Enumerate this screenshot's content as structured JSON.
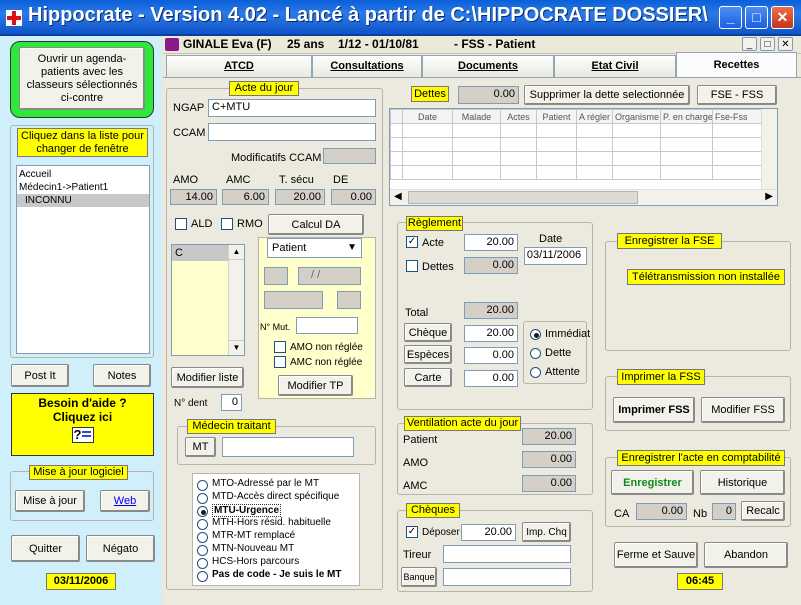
{
  "window": {
    "title": "Hippocrate - Version 4.02 - Lancé à partir de C:\\HIPPOCRATE DOSSIER\\",
    "min": "_",
    "max": "□",
    "close": "✕"
  },
  "sidebar": {
    "open_agenda": "Ouvrir un agenda-patients avec les classeurs sélectionnés ci-contre",
    "window_list_label": "Cliquez dans la liste pour changer de fenêtre",
    "window_list": [
      "Accueil",
      "Médecin1->Patient1",
      "INCONNU"
    ],
    "post_it": "Post It",
    "notes": "Notes",
    "help_line1": "Besoin d'aide ?",
    "help_line2": "Cliquez ici",
    "update_label": "Mise à jour logiciel",
    "update_button": "Mise à jour",
    "web_button": "Web",
    "quit": "Quitter",
    "negato": "Négato",
    "date": "03/11/2006"
  },
  "patient_bar": {
    "name": "GINALE Eva (F)",
    "age": "25 ans",
    "age_detail": "1/12 - 01/10/81",
    "status": "- FSS - Patient",
    "min": "_",
    "max": "□",
    "close": "✕"
  },
  "tabs": [
    "ATCD",
    "Consultations",
    "Documents",
    "Etat Civil",
    "Recettes"
  ],
  "acte": {
    "title": "Acte du jour",
    "ngap_label": "NGAP",
    "ngap_value": "C+MTU",
    "ccam_label": "CCAM",
    "ccam_value": "",
    "modifs_label": "Modificatifs CCAM",
    "amo_label": "AMO",
    "amc_label": "AMC",
    "tsecu_label": "T. sécu",
    "de_label": "DE",
    "amo": "14.00",
    "amc": "6.00",
    "tsecu": "20.00",
    "de": "0.00",
    "ald": "ALD",
    "rmo": "RMO",
    "calcul_da": "Calcul DA",
    "list_item": "C",
    "payer": "Patient",
    "date_placeholder": "/ /",
    "num_mut": "N° Mut.",
    "amo_non_reglee": "AMO non réglée",
    "amc_non_reglee": "AMC non réglée",
    "modifier_tp": "Modifier TP",
    "modifier_liste": "Modifier liste",
    "num_dent_label": "N° dent",
    "num_dent": "0"
  },
  "medecin": {
    "title": "Médecin traitant",
    "mt_button": "MT",
    "mt_value": ""
  },
  "mt_options": [
    "MTO-Adressé par le MT",
    "MTD-Accès direct spécifique",
    "MTU-Urgence",
    "MTH-Hors résid. habituelle",
    "MTR-MT remplacé",
    "MTN-Nouveau MT",
    "HCS-Hors parcours",
    "Pas de code - Je suis le MT"
  ],
  "mt_selected": 2,
  "dettes": {
    "title": "Dettes",
    "amount": "0.00",
    "delete_button": "Supprimer la dette selectionnée",
    "fse_fss_button": "FSE - FSS",
    "columns": [
      "Date",
      "Malade",
      "Actes",
      "Patient",
      "A régler",
      "Organisme",
      "P. en charge",
      "Fse-Fss"
    ],
    "rows": []
  },
  "reglement": {
    "title": "Règlement",
    "acte_label": "Acte",
    "acte_value": "20.00",
    "date_label": "Date",
    "date_value": "03/11/2006",
    "dettes_label": "Dettes",
    "dettes_value": "0.00",
    "total_label": "Total",
    "total_value": "20.00",
    "cheque": "Chèque",
    "cheque_value": "20.00",
    "especes": "Espèces",
    "especes_value": "0.00",
    "carte": "Carte",
    "carte_value": "0.00",
    "timing": [
      "Immédiat",
      "Dette",
      "Attente"
    ],
    "timing_selected": 0
  },
  "ventilation": {
    "title": "Ventilation acte du jour",
    "patient_label": "Patient",
    "patient": "20.00",
    "amo_label": "AMO",
    "amo": "0.00",
    "amc_label": "AMC",
    "amc": "0.00"
  },
  "cheques": {
    "title": "Chèques",
    "deposer": "Déposer",
    "amount": "20.00",
    "imp_chq": "Imp. Chq",
    "tireur_label": "Tireur",
    "banque_button": "Banque"
  },
  "fse": {
    "title": "Enregistrer la FSE",
    "status": "Télétransmission non installée"
  },
  "fss": {
    "title": "Imprimer la FSS",
    "print": "Imprimer FSS",
    "modify": "Modifier FSS"
  },
  "compta": {
    "title": "Enregistrer l'acte en comptabilité",
    "save": "Enregistrer",
    "history": "Historique",
    "ca_label": "CA",
    "ca_value": "0.00",
    "nb_label": "Nb",
    "nb_value": "0",
    "recalc": "Recalc"
  },
  "footer": {
    "close_save": "Ferme et Sauve",
    "cancel": "Abandon",
    "time": "06:45"
  }
}
